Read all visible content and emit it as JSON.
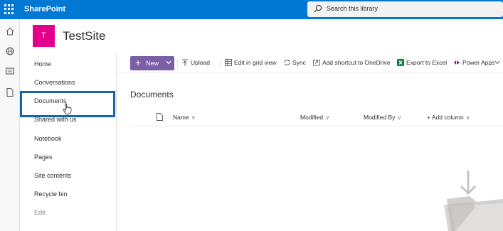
{
  "topbar": {
    "app_name": "SharePoint",
    "search_placeholder": "Search this library",
    "color": "#0078d4"
  },
  "site": {
    "logo_letter": "T",
    "title": "TestSite",
    "logo_color": "#e3008c"
  },
  "nav": {
    "items": [
      {
        "label": "Home"
      },
      {
        "label": "Conversations"
      },
      {
        "label": "Documents"
      },
      {
        "label": "Shared with us"
      },
      {
        "label": "Notebook"
      },
      {
        "label": "Pages"
      },
      {
        "label": "Site contents"
      },
      {
        "label": "Recycle bin"
      },
      {
        "label": "Edit"
      }
    ]
  },
  "commands": {
    "new_label": "New",
    "upload": "Upload",
    "grid_view": "Edit in grid view",
    "sync": "Sync",
    "shortcut": "Add shortcut to OneDrive",
    "excel": "Export to Excel",
    "power_apps": "Power Apps",
    "new_color": "#7b5ea7"
  },
  "library": {
    "title": "Documents",
    "columns": {
      "name": "Name",
      "modified": "Modified",
      "modified_by": "Modified By",
      "add_column": "+ Add column"
    }
  }
}
